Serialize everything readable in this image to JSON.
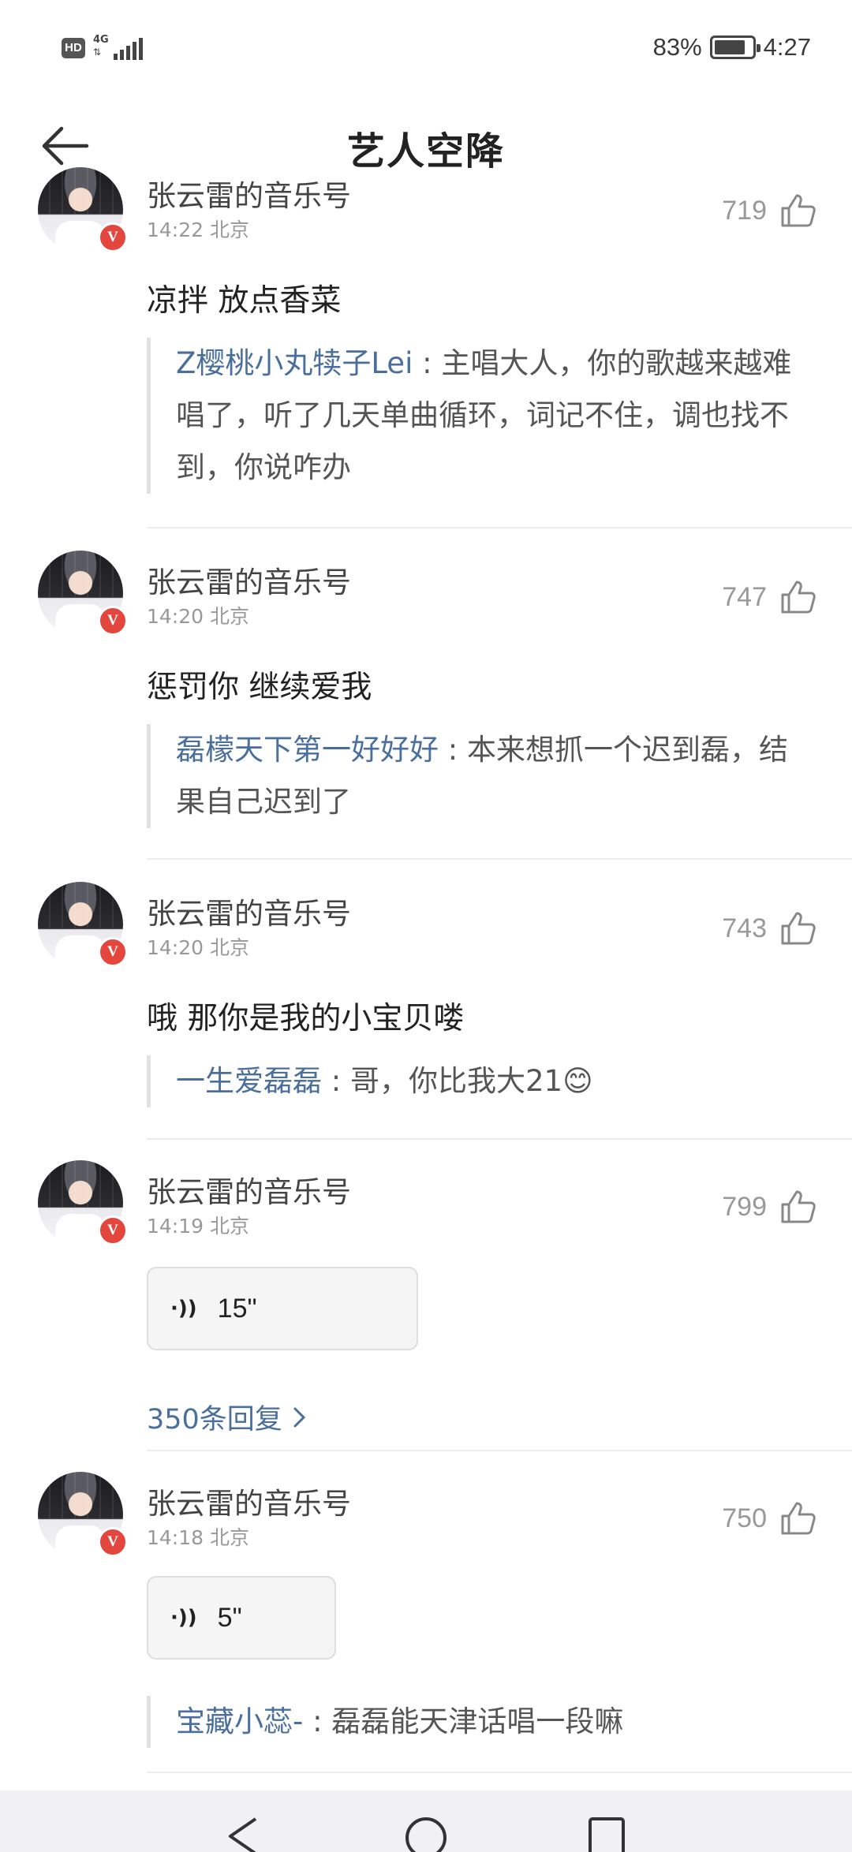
{
  "status_bar": {
    "hd": "HD",
    "network": "4G",
    "battery": "83%",
    "time": "4:27",
    "battery_level": 0.83
  },
  "header": {
    "title": "艺人空降",
    "back_icon": "back-arrow-icon"
  },
  "comments": [
    {
      "author": "张云雷的音乐号",
      "time": "14:22 北京",
      "likes": "719",
      "text": "凉拌 放点香菜",
      "quote_name": "Z樱桃小丸犊子Lei",
      "quote_sep": " : ",
      "quote_text": "主唱大人，你的歌越来越难唱了，听了几天单曲循环，词记不住，调也找不到，你说咋办"
    },
    {
      "author": "张云雷的音乐号",
      "time": "14:20 北京",
      "likes": "747",
      "text": "惩罚你 继续爱我",
      "quote_name": "磊檬天下第一好好好",
      "quote_sep": " : ",
      "quote_text": "本来想抓一个迟到磊，结果自己迟到了"
    },
    {
      "author": "张云雷的音乐号",
      "time": "14:20 北京",
      "likes": "743",
      "text": "哦 那你是我的小宝贝喽",
      "quote_name": "一生爱磊磊",
      "quote_sep": " : ",
      "quote_text": "哥，你比我大21😊"
    },
    {
      "author": "张云雷的音乐号",
      "time": "14:19 北京",
      "likes": "799",
      "voice_duration": "15\"",
      "replies": "350条回复"
    },
    {
      "author": "张云雷的音乐号",
      "time": "14:18 北京",
      "likes": "750",
      "voice_duration": "5\"",
      "quote_name": "宝藏小蕊-",
      "quote_sep": " : ",
      "quote_text": "磊磊能天津话唱一段嘛"
    }
  ],
  "verified_badge": "V",
  "voice_icon": "·))",
  "colors": {
    "link": "#4b6f9d",
    "badge": "#e2463d",
    "muted": "#999999"
  }
}
